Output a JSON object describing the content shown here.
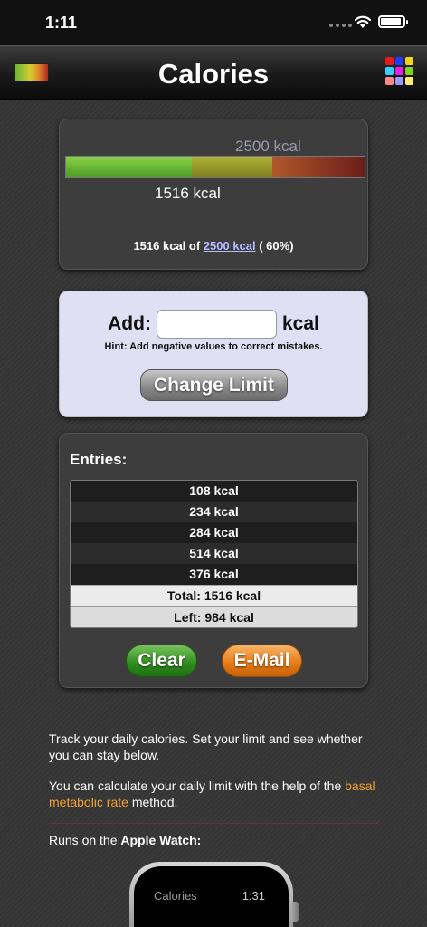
{
  "status_bar": {
    "time": "1:11"
  },
  "nav": {
    "title": "Calories",
    "grid_colors": [
      "#e21b1b",
      "#1f3cff",
      "#f5d21b",
      "#39d0ff",
      "#e61fe6",
      "#7dd621",
      "#ff8c8c",
      "#9a9aff",
      "#ffe97a"
    ]
  },
  "meter": {
    "limit_text": "2500 kcal",
    "consumed_text": "1516 kcal",
    "consumed": 1516,
    "limit": 2500,
    "summary_prefix": "1516 kcal of ",
    "summary_limit_link": "2500 kcal",
    "summary_suffix": " ( 60%)",
    "colors": {
      "green": "#5aa82a",
      "olive": "#8e8e24",
      "red": "#8a2a1e"
    }
  },
  "add": {
    "label": "Add:",
    "unit": "kcal",
    "input_value": "",
    "hint": "Hint: Add negative values to correct mistakes.",
    "change_limit_label": "Change Limit"
  },
  "entries": {
    "title": "Entries:",
    "items": [
      "108 kcal",
      "234 kcal",
      "284 kcal",
      "514 kcal",
      "376 kcal"
    ],
    "total": "Total: 1516 kcal",
    "left": "Left: 984 kcal",
    "clear_label": "Clear",
    "email_label": "E-Mail"
  },
  "info": {
    "paragraph1": "Track your daily calories. Set your limit and see whether you can stay below.",
    "paragraph2_prefix": "You can calculate your daily limit with the help of the ",
    "paragraph2_link": "basal metabolic rate",
    "paragraph2_suffix": " method.",
    "watch_prefix": "Runs on the ",
    "watch_bold": "Apple Watch:"
  },
  "watch": {
    "app_title": "Calories",
    "time": "1:31"
  }
}
